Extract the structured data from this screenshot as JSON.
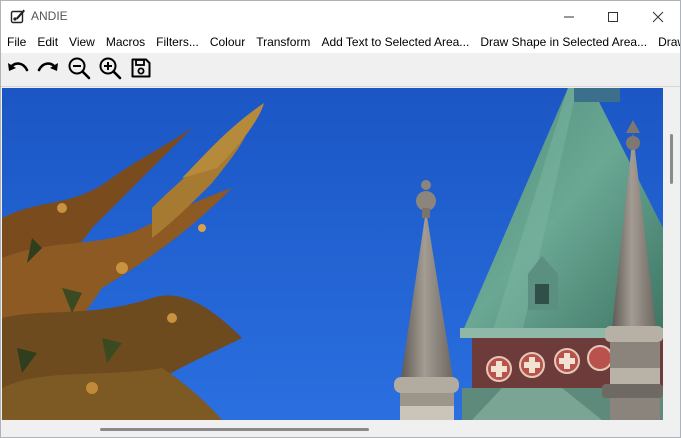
{
  "window": {
    "title": "ANDIE",
    "controls": [
      "minimize-icon",
      "maximize-icon",
      "close-icon"
    ]
  },
  "menu": {
    "items": [
      {
        "label": "File"
      },
      {
        "label": "Edit"
      },
      {
        "label": "View"
      },
      {
        "label": "Macros"
      },
      {
        "label": "Filters..."
      },
      {
        "label": "Colour"
      },
      {
        "label": "Transform"
      },
      {
        "label": "Add Text to Selected Area..."
      },
      {
        "label": "Draw Shape in Selected Area..."
      },
      {
        "label": "Draw"
      }
    ]
  },
  "toolbar": {
    "tools": [
      "undo-icon",
      "redo-icon",
      "zoom-out-icon",
      "zoom-in-icon",
      "save-icon"
    ]
  },
  "canvas": {
    "image": "church-spire-with-tree-photo",
    "colors": {
      "sky": "#1f5fd0",
      "copper_roof": "#5f9c8a",
      "spire": "#86807a",
      "foliage": "#8c5a22"
    }
  }
}
